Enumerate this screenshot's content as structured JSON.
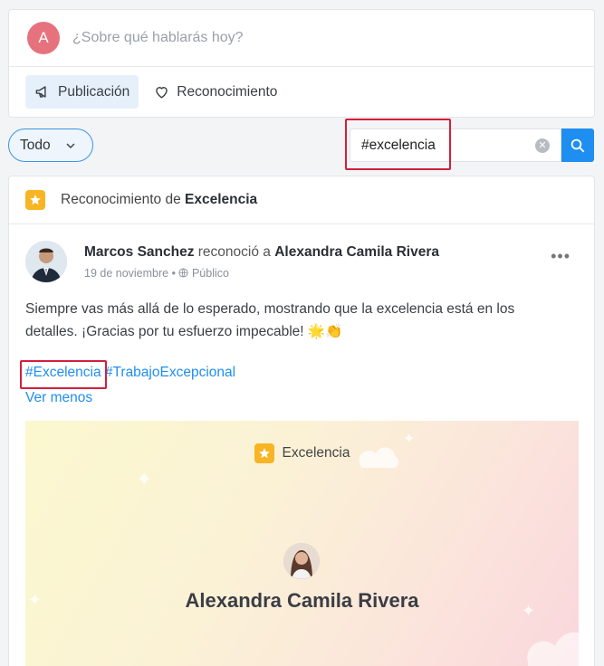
{
  "composer": {
    "avatar_initial": "A",
    "placeholder": "¿Sobre qué hablarás hoy?",
    "actions": [
      {
        "label": "Publicación",
        "icon": "megaphone-icon"
      },
      {
        "label": "Reconocimiento",
        "icon": "heart-icon"
      }
    ]
  },
  "filter": {
    "dropdown_label": "Todo",
    "search_value": "#excelencia"
  },
  "post": {
    "header_prefix": "Reconocimiento de ",
    "header_category": "Excelencia",
    "author": "Marcos Sanchez",
    "action_verb": " reconoció a ",
    "recipient": "Alexandra Camila Rivera",
    "date": "19 de noviembre",
    "visibility": "Público",
    "body_line1": "Siempre vas más allá de lo esperado, mostrando que la excelencia está en los",
    "body_line2": "detalles. ¡Gracias por tu esfuerzo impecable! 🌟👏",
    "hashtags": [
      "#Excelencia",
      "#TrabajoExcepcional"
    ],
    "toggle_label": "Ver menos",
    "card_title": "Excelencia",
    "card_recipient": "Alexandra Camila Rivera"
  },
  "colors": {
    "accent": "#1f8ef1",
    "highlight": "#d21f3c",
    "star_badge": "#f7b524"
  }
}
